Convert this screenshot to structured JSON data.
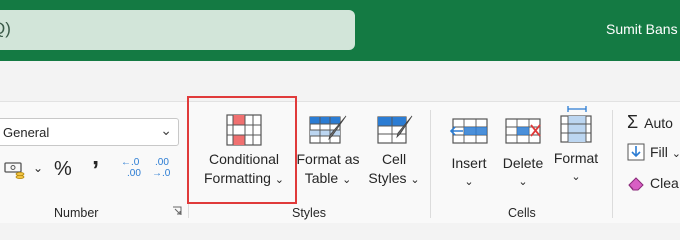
{
  "titlebar": {
    "search_glyph": "Q)",
    "user_name": "Sumit Bans"
  },
  "number_group": {
    "format_value": "General",
    "percent": "%",
    "comma": "’",
    "increase_decimal_top": "←.0",
    "increase_decimal_bottom": ".00",
    "decrease_decimal_top": ".00",
    "decrease_decimal_bottom": "→.0",
    "label": "Number"
  },
  "styles_group": {
    "conditional_formatting": [
      "Conditional",
      "Formatting"
    ],
    "format_as_table": [
      "Format as",
      "Table"
    ],
    "cell_styles": [
      "Cell",
      "Styles"
    ],
    "label": "Styles"
  },
  "cells_group": {
    "insert": "Insert",
    "delete": "Delete",
    "format": "Format",
    "label": "Cells"
  },
  "editing_group": {
    "autosum": "Auto",
    "fill": "Fill",
    "clear": "Clea"
  },
  "colors": {
    "titlebar": "#147a43",
    "highlight": "#e03a3a",
    "accent_blue": "#2b7cd3",
    "accent_red": "#f07070"
  }
}
